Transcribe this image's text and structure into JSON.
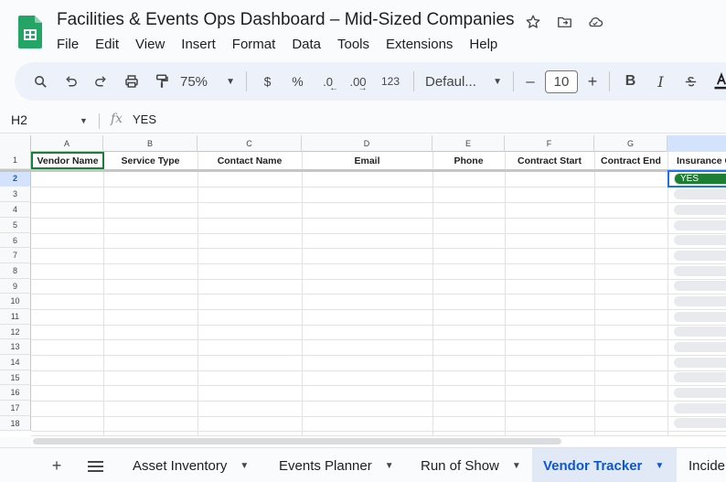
{
  "doc": {
    "title": "Facilities & Events Ops Dashboard – Mid-Sized Companies"
  },
  "menu": [
    "File",
    "Edit",
    "View",
    "Insert",
    "Format",
    "Data",
    "Tools",
    "Extensions",
    "Help"
  ],
  "toolbar": {
    "zoom": "75%",
    "currency": "$",
    "percent": "%",
    "dec_decrease": ".0",
    "dec_increase": ".00",
    "number_format": "123",
    "font": "Defaul...",
    "font_size": "10",
    "minus": "–",
    "plus": "+",
    "bold": "B",
    "italic": "I"
  },
  "formula_bar": {
    "cell_ref": "H2",
    "fx": "fx",
    "value": "YES"
  },
  "columns": [
    "A",
    "B",
    "C",
    "D",
    "E",
    "F",
    "G",
    "H"
  ],
  "rows": [
    "1",
    "2",
    "3",
    "4",
    "5",
    "6",
    "7",
    "8",
    "9",
    "10",
    "11",
    "12",
    "13",
    "14",
    "15",
    "16",
    "17",
    "18"
  ],
  "header_row": [
    "Vendor Name",
    "Service Type",
    "Contact Name",
    "Email",
    "Phone",
    "Contract Start",
    "Contract End",
    "Insurance C"
  ],
  "cells": {
    "H2": "YES"
  },
  "tabs": [
    {
      "label": "Asset Inventory",
      "active": false
    },
    {
      "label": "Events Planner",
      "active": false
    },
    {
      "label": "Run of Show",
      "active": false
    },
    {
      "label": "Vendor Tracker",
      "active": true
    },
    {
      "label": "Incide",
      "active": false
    }
  ],
  "colors": {
    "accent": "#0b57d0",
    "selection": "#1a73e8",
    "yes_chip": "#1e7e34",
    "active_cell": "#188038"
  }
}
